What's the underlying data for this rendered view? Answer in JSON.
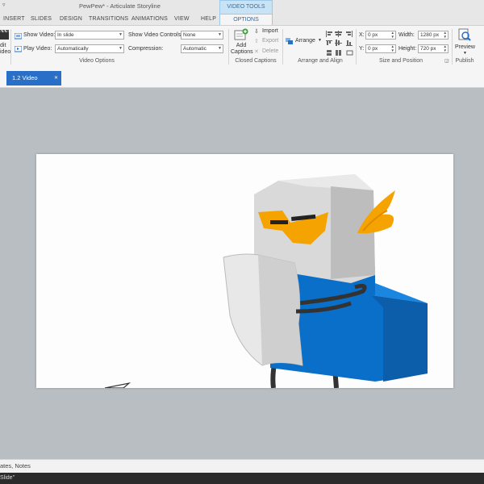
{
  "titlebar": {
    "title": "PewPew* - Articulate Storyline",
    "quick_access": "▿",
    "video_tools": "VIDEO TOOLS"
  },
  "tabs": [
    "INSERT",
    "SLIDES",
    "DESIGN",
    "TRANSITIONS",
    "ANIMATIONS",
    "VIEW",
    "HELP"
  ],
  "active_tab": "OPTIONS",
  "ribbon": {
    "edit_video_label": "dit\nideo",
    "show_video_label": "Show Video:",
    "show_video_value": "In slide",
    "play_video_label": "Play Video:",
    "play_video_value": "Automatically",
    "show_controls_label": "Show Video Controls",
    "show_controls_value": "None",
    "compression_label": "Compression:",
    "compression_value": "Automatic",
    "group_video_options": "Video Options",
    "add_captions_label": "Add\nCaptions",
    "import_label": "Import",
    "export_label": "Export",
    "delete_label": "Delete",
    "group_closed_captions": "Closed Captions",
    "arrange_label": "Arrange",
    "group_arrange": "Arrange and Align",
    "x_label": "X:",
    "x_value": "0 px",
    "y_label": "Y:",
    "y_value": "0 px",
    "width_label": "Width:",
    "width_value": "1280 px",
    "height_label": "Height:",
    "height_value": "720 px",
    "group_size": "Size and Position",
    "preview_label": "Preview",
    "group_publish": "Publish"
  },
  "document_tab": "1.2 Video",
  "notes_bar": "ates, Notes",
  "status_bar": "Slide\"",
  "colors": {
    "accent": "#2a6fc7",
    "knight_blue": "#0a6fc8",
    "visor_orange": "#f5a300",
    "helmet_gray": "#d9d9d9"
  }
}
